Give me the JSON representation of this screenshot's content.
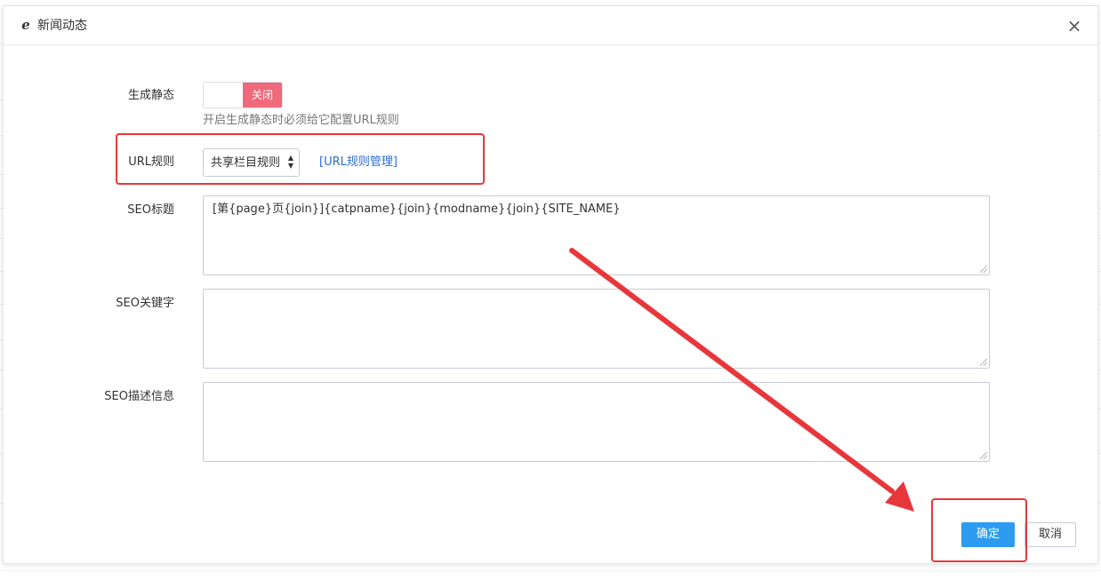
{
  "dialog": {
    "title": "新闻动态",
    "title_icon": "ie-logo-icon",
    "close_icon": "close-icon",
    "close_glyph": "×"
  },
  "form": {
    "static": {
      "label": "生成静态",
      "switch_state": "关闭",
      "help": "开启生成静态时必须给它配置URL规则"
    },
    "url_rule": {
      "label": "URL规则",
      "selected": "共享栏目规则",
      "manage_link": "[URL规则管理]"
    },
    "seo_title": {
      "label": "SEO标题",
      "value": "[第{page}页{join}]{catpname}{join}{modname}{join}{SITE_NAME}"
    },
    "seo_keywords": {
      "label": "SEO关键字",
      "value": ""
    },
    "seo_description": {
      "label": "SEO描述信息",
      "value": ""
    }
  },
  "footer": {
    "ok_label": "确定",
    "cancel_label": "取消"
  },
  "colors": {
    "accent": "#2d9cf0",
    "switch_off": "#ef6a7a",
    "annotation_red": "#e8373a",
    "link": "#2b6cd8"
  }
}
